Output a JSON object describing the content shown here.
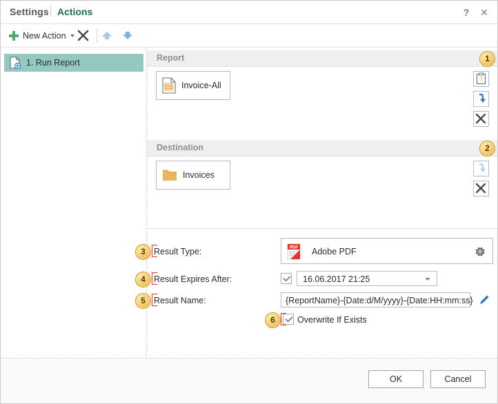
{
  "window": {
    "title_primary": "Settings",
    "title_active": "Actions",
    "help_icon": "?",
    "close_icon": "✕"
  },
  "toolbar": {
    "new_action_label": "New Action",
    "new_action_caret": "▾",
    "delete_icon": "delete-x-icon",
    "move_up_icon": "arrow-up-icon",
    "move_down_icon": "arrow-down-icon"
  },
  "sidebar": {
    "items": [
      {
        "label": "1. Run Report",
        "icon": "run-report-icon",
        "selected": true
      }
    ]
  },
  "panels": {
    "report": {
      "title": "Report",
      "badge": "1",
      "item": {
        "label": "Invoice-All",
        "icon": "report-file-icon"
      },
      "buttons": [
        {
          "name": "report-properties-button",
          "icon": "clipboard-icon",
          "enabled": true
        },
        {
          "name": "report-download-button",
          "icon": "down-arrow-icon",
          "enabled": true
        },
        {
          "name": "report-remove-button",
          "icon": "remove-x-icon",
          "enabled": true
        }
      ]
    },
    "destination": {
      "title": "Destination",
      "badge": "2",
      "item": {
        "label": "Invoices",
        "icon": "folder-icon"
      },
      "buttons": [
        {
          "name": "destination-download-button",
          "icon": "down-arrow-icon",
          "enabled": false
        },
        {
          "name": "destination-remove-button",
          "icon": "remove-x-icon",
          "enabled": true
        }
      ]
    }
  },
  "form": {
    "result_type": {
      "badge": "3",
      "label": "Result Type:",
      "value": "Adobe PDF",
      "icon": "pdf-icon",
      "settings_icon": "gear-icon"
    },
    "result_expires": {
      "badge": "4",
      "label": "Result Expires After:",
      "checked": true,
      "value": "16.06.2017 21:25",
      "dropdown_icon": "chevron-down-icon"
    },
    "result_name": {
      "badge": "5",
      "label": "Result Name:",
      "value": "{ReportName}-{Date:d/M/yyyy}-{Date:HH:mm:ss}",
      "edit_icon": "pencil-icon"
    },
    "overwrite": {
      "badge": "6",
      "label": "Overwrite If Exists",
      "checked": true
    }
  },
  "footer": {
    "ok_label": "OK",
    "cancel_label": "Cancel"
  },
  "colors": {
    "accent_teal": "#1f6b5a",
    "selection": "#95c9bf",
    "panel_header": "#efefef",
    "badge_gold": "#fcd271",
    "annotation_red": "#e8312a",
    "pdf_red": "#e8322c",
    "folder_gold": "#e7b55b",
    "arrow_blue": "#2f7dc0"
  }
}
